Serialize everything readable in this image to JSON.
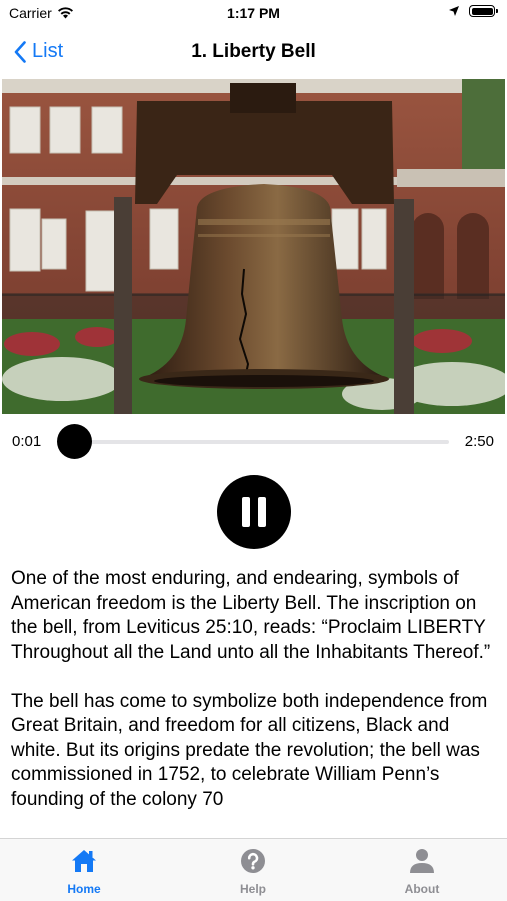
{
  "status_bar": {
    "carrier": "Carrier",
    "time": "1:17 PM"
  },
  "nav": {
    "back_label": "List",
    "title": "1. Liberty Bell"
  },
  "player": {
    "current_time": "0:01",
    "duration": "2:50",
    "progress": 0.006
  },
  "description": [
    "One of the most enduring, and endearing, symbols of American freedom is the Liberty Bell. The inscription on the bell, from Leviticus 25:10, reads: “Proclaim LIBERTY Throughout all the Land unto all the Inhabitants Thereof.”",
    "The bell has come to symbolize both independence from Great Britain, and freedom for all citizens, Black and white. But its origins predate the revolution; the bell was commissioned in 1752, to celebrate William Penn’s founding of the colony 70"
  ],
  "tabs": [
    {
      "label": "Home",
      "icon": "house-icon",
      "active": true
    },
    {
      "label": "Help",
      "icon": "question-circle-icon",
      "active": false
    },
    {
      "label": "About",
      "icon": "person-icon",
      "active": false
    }
  ],
  "colors": {
    "accent": "#1479f5",
    "inactive": "#8e8e93"
  }
}
